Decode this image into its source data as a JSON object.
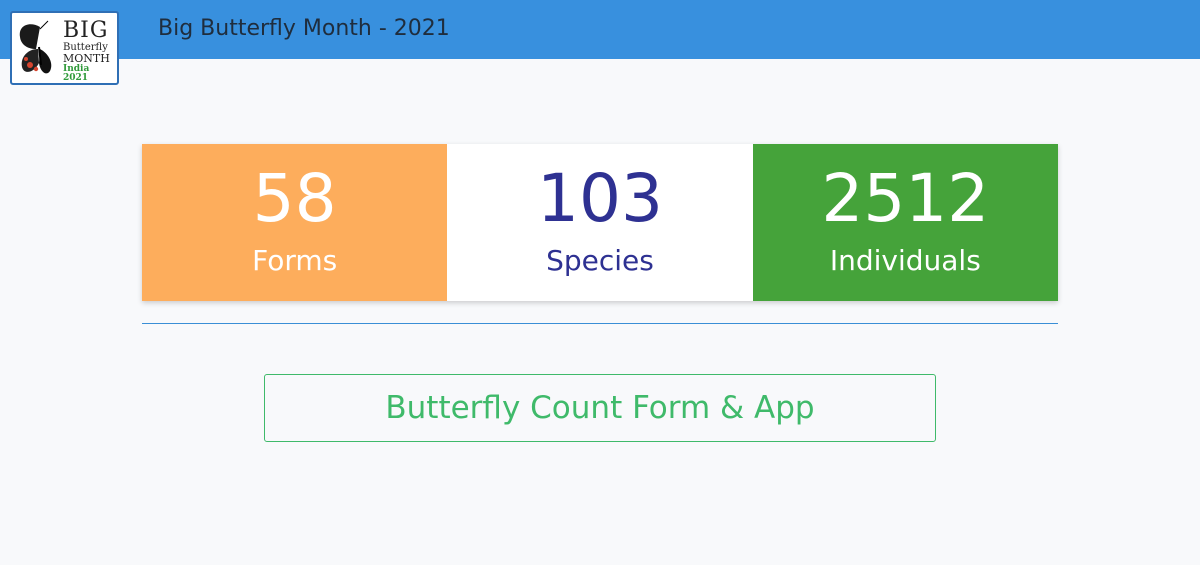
{
  "navbar": {
    "title": "Big Butterfly Month - 2021",
    "background": "#3890de"
  },
  "logo": {
    "line1": "Big",
    "line2": "Butterfly",
    "line3": "Month",
    "line4": "India 2021",
    "icon": "butterfly-icon"
  },
  "stats": [
    {
      "value": "58",
      "label": "Forms",
      "background": "#fdad5c",
      "color": "#ffffff"
    },
    {
      "value": "103",
      "label": "Species",
      "background": "#ffffff",
      "color": "#2e3192"
    },
    {
      "value": "2512",
      "label": "Individuals",
      "background": "#45a33a",
      "color": "#ffffff"
    }
  ],
  "cta": {
    "label": "Butterfly Count Form & App",
    "color": "#3fba6a"
  }
}
